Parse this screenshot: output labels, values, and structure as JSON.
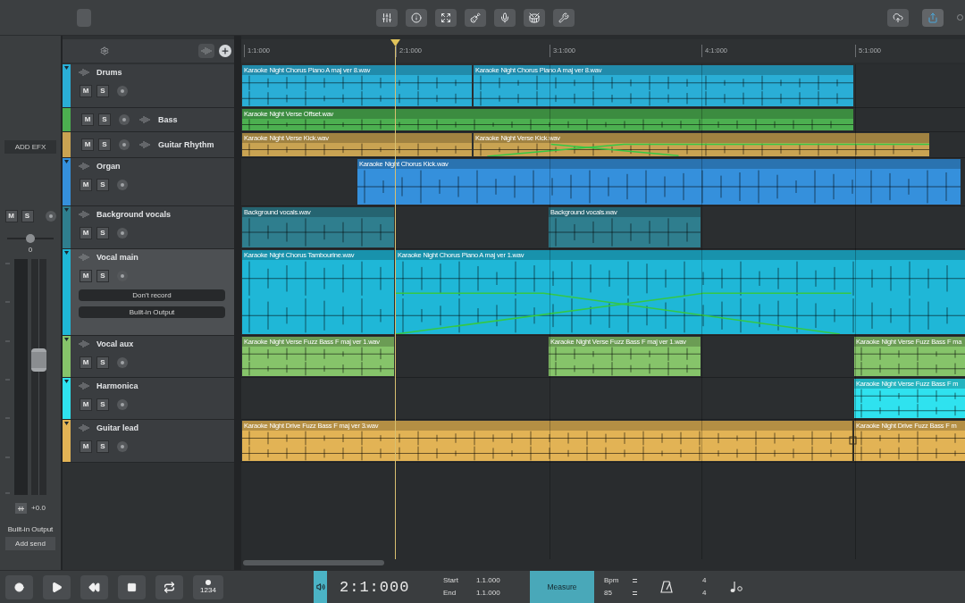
{
  "mixer_strip": {
    "effects_button": "ADD EFX",
    "mute_label": "M",
    "solo_label": "S",
    "pan": {
      "level": 0.5,
      "reading": "0"
    },
    "fader": {
      "level": 0.58,
      "reading": "+0.0"
    },
    "output": "Built-in Output",
    "send_button": "Add send"
  },
  "ruler": {
    "markers": [
      "1:1:000",
      "2:1:000",
      "3:1:000",
      "4:1:000",
      "5:1:000"
    ]
  },
  "tracks": [
    {
      "name": "Drums",
      "kind": "stacked",
      "color": "#2aaed6",
      "selected": false,
      "mute_label": "M",
      "solo_label": "S",
      "clips": [
        {
          "name": "Karaoke Night Chorus Piano A maj ver 8.wav"
        },
        {
          "name": "Karaoke Night Chorus Piano A maj ver 8.wav"
        }
      ]
    },
    {
      "name": "Bass",
      "kind": "inline",
      "color": "#4caf50",
      "selected": false,
      "mute_label": "M",
      "solo_label": "S",
      "clips": [
        {
          "name": "Karaoke Night Verse Offset.wav"
        }
      ]
    },
    {
      "name": "Guitar Rhythm",
      "kind": "inline",
      "color": "#c9a352",
      "selected": false,
      "mute_label": "M",
      "solo_label": "S",
      "clips": [
        {
          "name": "Karaoke Night Verse Kick.wav"
        },
        {
          "name": "Karaoke Night Verse Kick.wav"
        }
      ]
    },
    {
      "name": "Organ",
      "kind": "stacked",
      "color": "#3590dc",
      "selected": false,
      "mute_label": "M",
      "solo_label": "S",
      "clips": [
        {
          "name": "Karaoke Night Chorus Kick.wav"
        }
      ]
    },
    {
      "name": "Background vocals",
      "kind": "stacked",
      "color": "#2f7e8e",
      "selected": false,
      "mute_label": "M",
      "solo_label": "S",
      "clips": [
        {
          "name": "Background vocals.wav"
        },
        {
          "name": "Background vocals.wav"
        }
      ]
    },
    {
      "name": "Vocal main",
      "kind": "stacked",
      "color": "#1fb7d7",
      "selected": true,
      "mute_label": "M",
      "solo_label": "S",
      "input": "Don't record",
      "output": "Built-in Output",
      "clips": [
        {
          "name": "Karaoke Night Chorus Tambourine.wav"
        },
        {
          "name": "Karaoke Night Chorus Piano A maj ver 1.wav"
        }
      ]
    },
    {
      "name": "Vocal aux",
      "kind": "stacked",
      "color": "#86c46a",
      "selected": false,
      "mute_label": "M",
      "solo_label": "S",
      "clips": [
        {
          "name": "Karaoke Night Verse Fuzz Bass F maj ver 1.wav"
        },
        {
          "name": "Karaoke Night Verse Fuzz Bass F maj ver 1.wav"
        },
        {
          "name": "Karaoke Night Verse Fuzz Bass F ma"
        }
      ]
    },
    {
      "name": "Harmonica",
      "kind": "stacked",
      "color": "#2fe2ef",
      "selected": false,
      "mute_label": "M",
      "solo_label": "S",
      "clips": [
        {
          "name": "Karaoke Night Verse Fuzz Bass F m"
        }
      ]
    },
    {
      "name": "Guitar lead",
      "kind": "stacked",
      "color": "#e2b355",
      "selected": false,
      "mute_label": "M",
      "solo_label": "S",
      "clips": [
        {
          "name": "Karaoke Night Drive Fuzz Bass F maj ver 3.wav"
        },
        {
          "name": "Karaoke Night Drive Fuzz Bass F m"
        }
      ]
    }
  ],
  "transport": {
    "count_in": "1234",
    "time": "2:1:000",
    "start_label": "Start",
    "start": "1.1.000",
    "end_label": "End",
    "end": "1.1.000",
    "mode_button": "Measure",
    "tempo_label": "Bpm",
    "tempo": "85",
    "time_signature": [
      "4",
      "4"
    ]
  }
}
